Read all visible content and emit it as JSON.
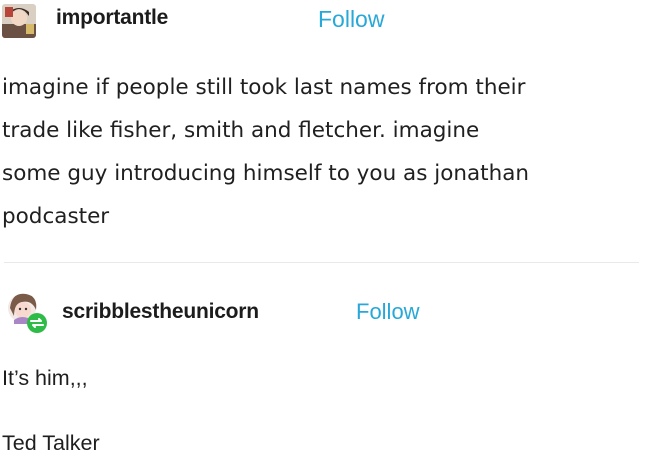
{
  "post1": {
    "username": "importantle",
    "follow_label": "Follow",
    "body": "imagine if people still took last names from their\ntrade like fisher, smith and fletcher. imagine\nsome guy introducing himself to you as jonathan\npodcaster",
    "avatar_icon": "user-avatar-icon"
  },
  "post2": {
    "username": "scribblestheunicorn",
    "follow_label": "Follow",
    "lines": [
      "It’s him,,,",
      "Ted Talker"
    ],
    "avatar_icon": "user-avatar-icon",
    "reblog_badge_icon": "reblog-icon"
  },
  "colors": {
    "accent": "#28a8d8",
    "reblog_badge": "#2fbb47"
  }
}
